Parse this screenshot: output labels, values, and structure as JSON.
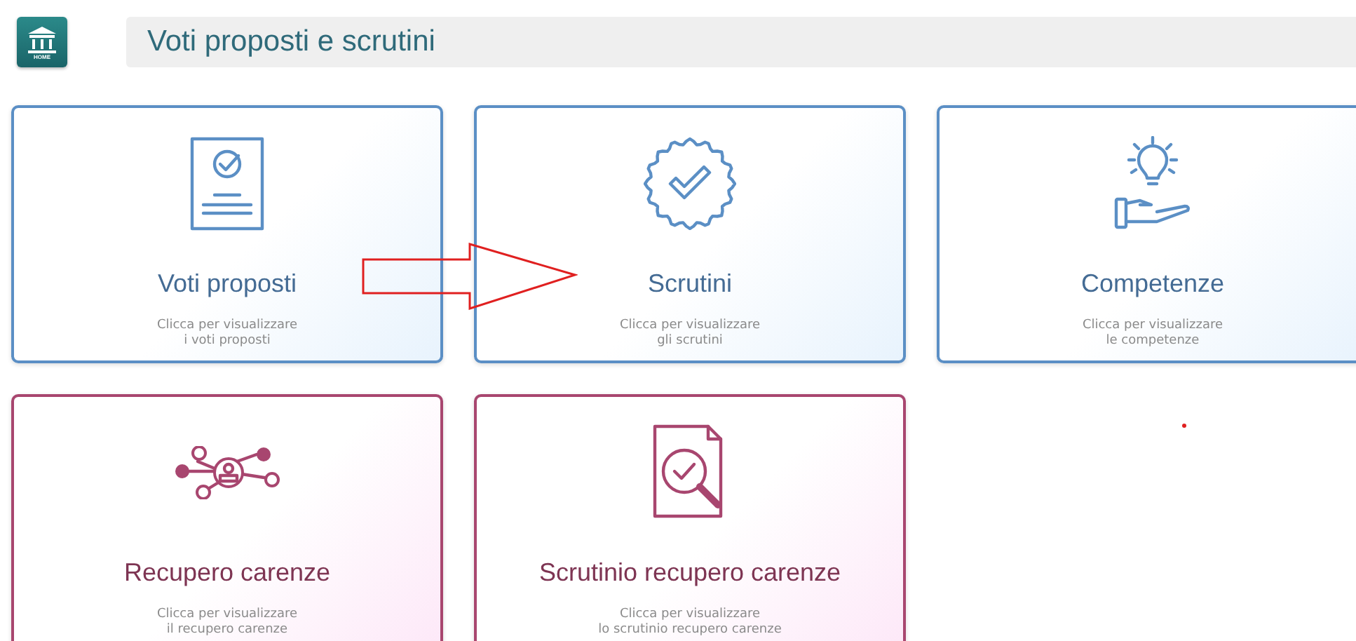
{
  "header": {
    "home_label": "HOME",
    "title": "Voti proposti e scrutini"
  },
  "cards": [
    {
      "title": "Voti proposti",
      "description": [
        "Clicca per visualizzare",
        "i voti proposti"
      ],
      "color": "#5b8fc5"
    },
    {
      "title": "Scrutini",
      "description": [
        "Clicca per visualizzare",
        "gli scrutini"
      ],
      "color": "#5b8fc5"
    },
    {
      "title": "Competenze",
      "description": [
        "Clicca per visualizzare",
        "le competenze"
      ],
      "color": "#5b8fc5"
    },
    {
      "title": "Recupero carenze",
      "description": [
        "Clicca per visualizzare",
        "il recupero carenze"
      ],
      "color": "#a8466f"
    },
    {
      "title": "Scrutinio recupero carenze",
      "description": [
        "Clicca per visualizzare",
        "lo scrutinio recupero carenze"
      ],
      "color": "#a8466f"
    }
  ]
}
